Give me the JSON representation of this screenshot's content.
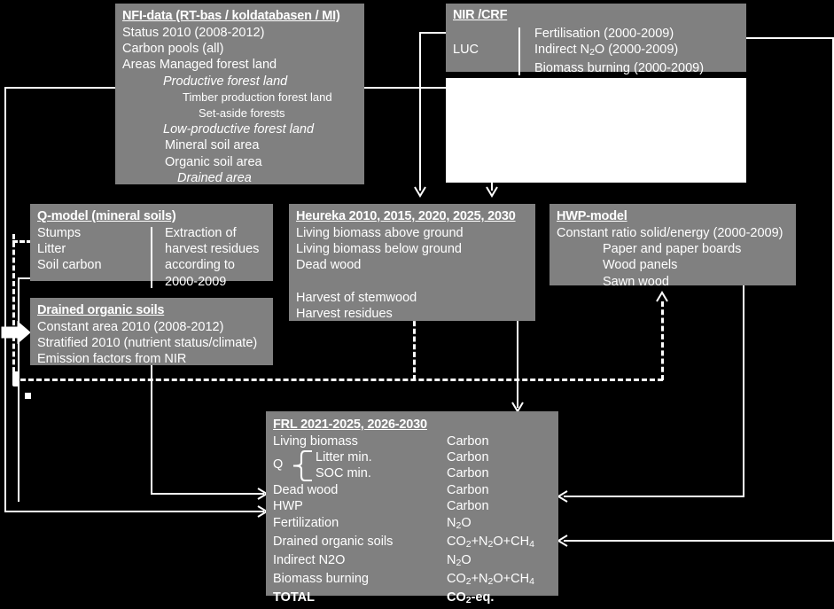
{
  "meta": {
    "title": "Swedish Forest Reference Level (FRL) calculation flow diagram",
    "background_color": "#000000",
    "box_color": "#808080",
    "text_color": "#ffffff"
  },
  "boxes": {
    "nfi": {
      "header": "NFI-data (RT-bas / koldatabasen / MI)",
      "lines": [
        "Status 2010 (2008-2012)",
        "Carbon pools (all)",
        "Areas  Managed forest land",
        "Productive forest land",
        "Timber production forest land",
        "Set-aside forests",
        "Low-productive forest land",
        "Mineral soil area",
        "Organic soil area",
        "Drained area"
      ]
    },
    "nir": {
      "header": "NIR /CRF",
      "luc": "LUC",
      "items": [
        "Fertilisation (2000-2009)",
        "Indirect N2O (2000-2009)",
        "Biomass burning  (2000-2009)"
      ]
    },
    "qmodel": {
      "header": "Q-model (mineral soils)",
      "left": [
        "Stumps",
        "Litter",
        "Soil carbon"
      ],
      "right": [
        "Extraction of",
        "harvest residues",
        "according to",
        "2000-2009"
      ]
    },
    "drained": {
      "header": "Drained organic soils",
      "lines": [
        "Constant area 2010 (2008-2012)",
        "Stratified 2010 (nutrient status/climate)",
        "Emission factors from NIR"
      ]
    },
    "heureka": {
      "header": "Heureka 2010, 2015, 2020, 2025, 2030",
      "group1": [
        "Living biomass above ground",
        "Living biomass below ground",
        "Dead wood"
      ],
      "group2": [
        "Harvest of stemwood",
        "Harvest residues"
      ]
    },
    "hwp": {
      "header": "HWP-model",
      "line1": "Constant ratio solid/energy (2000-2009)",
      "items": [
        "Paper and paper boards",
        "Wood panels",
        "Sawn wood"
      ]
    },
    "frl": {
      "header": "FRL 2021-2025, 2026-2030",
      "q_label": "Q",
      "rows": [
        {
          "label": "Living biomass",
          "value": "Carbon",
          "bold": false
        },
        {
          "label": "Litter    min.",
          "value": "Carbon",
          "bold": false
        },
        {
          "label": "SOC    min.",
          "value": "Carbon",
          "bold": false
        },
        {
          "label": "Dead wood",
          "value": "Carbon",
          "bold": false
        },
        {
          "label": "HWP",
          "value": "Carbon",
          "bold": false
        },
        {
          "label": "Fertilization",
          "value": "N2O",
          "bold": false
        },
        {
          "label": "Drained organic soils",
          "value": "CO2+N2O+CH4",
          "bold": false
        },
        {
          "label": "Indirect N2O",
          "value": "N2O",
          "bold": false
        },
        {
          "label": "Biomass burning",
          "value": "CO2+N2O+CH4",
          "bold": false
        },
        {
          "label": "TOTAL",
          "value": "CO2-eq.",
          "bold": true
        }
      ]
    }
  }
}
